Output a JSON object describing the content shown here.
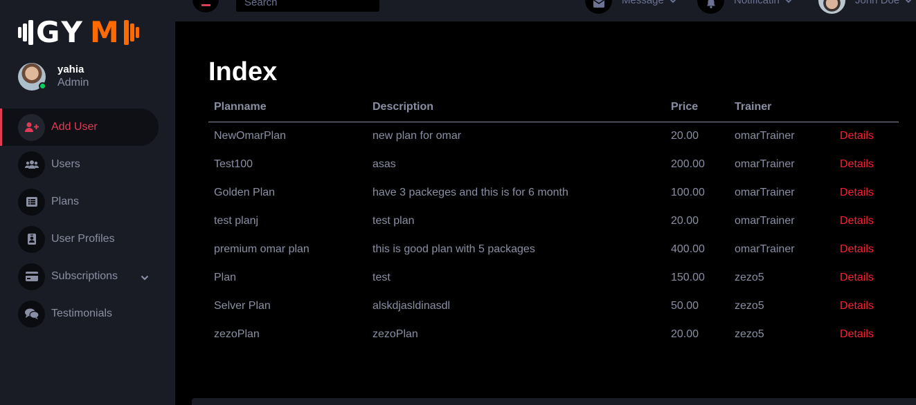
{
  "brand": {
    "logo_part1": "GY",
    "logo_part2": "M",
    "accent": "#ff6a00"
  },
  "user": {
    "name": "yahia",
    "role": "Admin",
    "status_color": "#00d25b"
  },
  "sidebar": {
    "items": [
      {
        "label": "Add User",
        "icon": "user-plus-icon",
        "active": true
      },
      {
        "label": "Users",
        "icon": "users-icon"
      },
      {
        "label": "Plans",
        "icon": "list-icon"
      },
      {
        "label": "User Profiles",
        "icon": "id-badge-icon"
      },
      {
        "label": "Subscriptions",
        "icon": "credit-card-icon",
        "has_dropdown": true
      },
      {
        "label": "Testimonials",
        "icon": "comments-icon"
      }
    ]
  },
  "topbar": {
    "search_placeholder": "Search",
    "message_label": "Message",
    "notification_label": "Notificatin",
    "profile_name": "John Doe"
  },
  "page": {
    "title": "Index"
  },
  "table": {
    "headers": [
      "Planname",
      "Description",
      "Price",
      "Trainer",
      ""
    ],
    "rows": [
      {
        "planname": "NewOmarPlan",
        "description": "new plan for omar",
        "price": "20.00",
        "trainer": "omarTrainer",
        "action": "Details"
      },
      {
        "planname": "Test100",
        "description": "asas",
        "price": "200.00",
        "trainer": "omarTrainer",
        "action": "Details"
      },
      {
        "planname": "Golden Plan",
        "description": "have 3 packeges and this is for 6 month",
        "price": "100.00",
        "trainer": "omarTrainer",
        "action": "Details"
      },
      {
        "planname": "test planj",
        "description": "test plan",
        "price": "20.00",
        "trainer": "omarTrainer",
        "action": "Details"
      },
      {
        "planname": "premium omar plan",
        "description": "this is good plan with 5 packages",
        "price": "400.00",
        "trainer": "omarTrainer",
        "action": "Details"
      },
      {
        "planname": "Plan",
        "description": "test",
        "price": "150.00",
        "trainer": "zezo5",
        "action": "Details"
      },
      {
        "planname": "Selver Plan",
        "description": "alskdjasldinasdl",
        "price": "50.00",
        "trainer": "zezo5",
        "action": "Details"
      },
      {
        "planname": "zezoPlan",
        "description": "zezoPlan",
        "price": "20.00",
        "trainer": "zezo5",
        "action": "Details"
      }
    ]
  },
  "colors": {
    "sidebar_bg": "#191c24",
    "main_bg": "#000000",
    "danger": "#ff1f2f",
    "active": "#e03b55",
    "muted": "#8a8fa3"
  }
}
